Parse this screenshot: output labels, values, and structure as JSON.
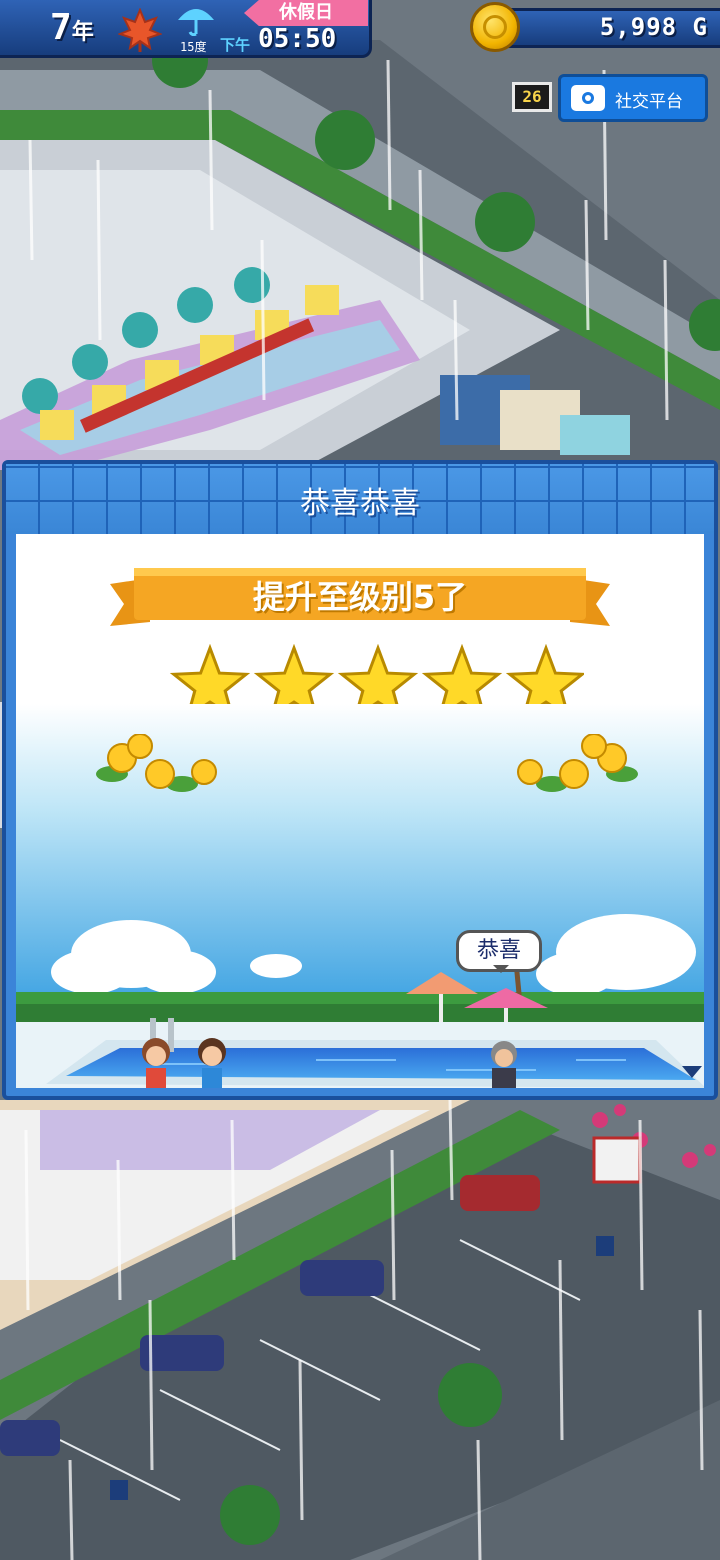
{
  "hud": {
    "year": "7",
    "year_unit": "年",
    "season_icon": "maple-leaf-icon",
    "weather_icon": "umbrella-rain-icon",
    "temperature": "15度",
    "period": "下午",
    "time": "05:50",
    "day_type": "休假日",
    "gold": "5,998",
    "gold_unit": "G",
    "date_badge": "26",
    "social_label": "社交平台"
  },
  "dialog": {
    "title": "恭喜恭喜",
    "ribbon_text": "提升至级别5了",
    "stars": 5,
    "speech": "恭喜"
  },
  "colors": {
    "hud_blue": "#2f63b6",
    "holiday_pink": "#f26fa2",
    "gold": "#f2b400",
    "dialog_blue": "#3b84d8",
    "ribbon_orange": "#f5a623",
    "star_yellow": "#ffd928",
    "social_blue": "#1a79e0"
  }
}
